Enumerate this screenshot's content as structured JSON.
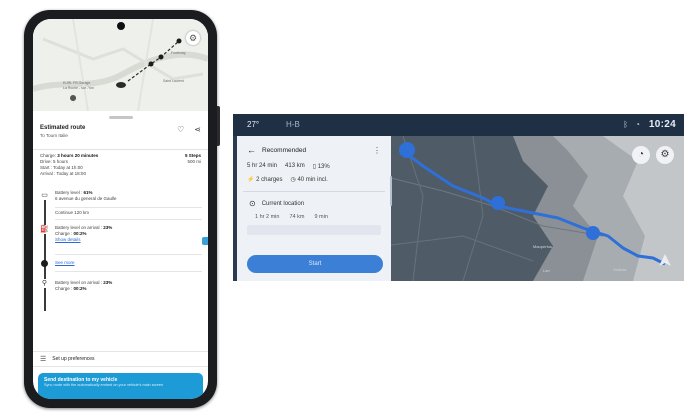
{
  "phone": {
    "map": {
      "labels": [
        "EURL FB Garage",
        "La Roche - sur -Yon",
        "Fontenay",
        "Saint Laurent"
      ],
      "settings_icon": "gear-icon"
    },
    "route": {
      "title": "Estimated route",
      "subtitle": "To Tourn Italie",
      "favorite_icon": "heart-outline-icon",
      "share_icon": "share-icon"
    },
    "summary": {
      "charge_label": "Charge:",
      "charge_value": "3 hours 20 minutes",
      "stops_value": "5 Steps",
      "drive_label": "Drive:",
      "drive_value": "5 hours",
      "distance_value": "500 mi",
      "start_value": "Start : Today at 1h:00",
      "arrival_value": "Arrival : Today at 18:00"
    },
    "timeline": {
      "start_battery_label": "Battery level :",
      "start_battery_value": "61%",
      "start_address": "6 avenue du general de Gaulle",
      "continue_text": "Continue 120 km",
      "arrival1_label": "Battery level on arrival :",
      "arrival1_value": "23%",
      "charge1_label": "Charge :",
      "charge1_value": "00:2%",
      "show_details": "Show details",
      "see_more": "See more",
      "arrival2_label": "Battery level on arrival :",
      "arrival2_value": "23%",
      "charge2_label": "Charge :",
      "charge2_value": "00:2%"
    },
    "prefs_label": "Set up preferences",
    "cta": {
      "title": "Send destination to my vehicle",
      "subtitle": "Sync route with the automatically embed on your vehicle's main screen"
    }
  },
  "car": {
    "status": {
      "temperature": "27°",
      "mode": "H-B",
      "time": "10:24",
      "bluetooth_icon": "bluetooth-icon",
      "wifi_icon": "wifi-icon"
    },
    "panel": {
      "heading": "Recommended",
      "duration": "5 hr 24 min",
      "distance": "413 km",
      "battery": "13%",
      "charges": "2 charges",
      "charge_time": "40 min incl.",
      "location_label": "Current location",
      "leg_time": "1 hr 2 min",
      "leg_distance": "74 km",
      "leg_battery": "9 min",
      "start_button": "Start"
    },
    "map": {
      "controls": [
        "speedometer-icon",
        "gear-icon"
      ],
      "town_labels": [
        "Maupertus",
        "Vorbois",
        "Lan"
      ]
    }
  },
  "colors": {
    "route_blue": "#2f6fd8",
    "cta_blue": "#1c9bd6",
    "car_background": "#2c3b4f",
    "start_button": "#3b7fd6"
  }
}
